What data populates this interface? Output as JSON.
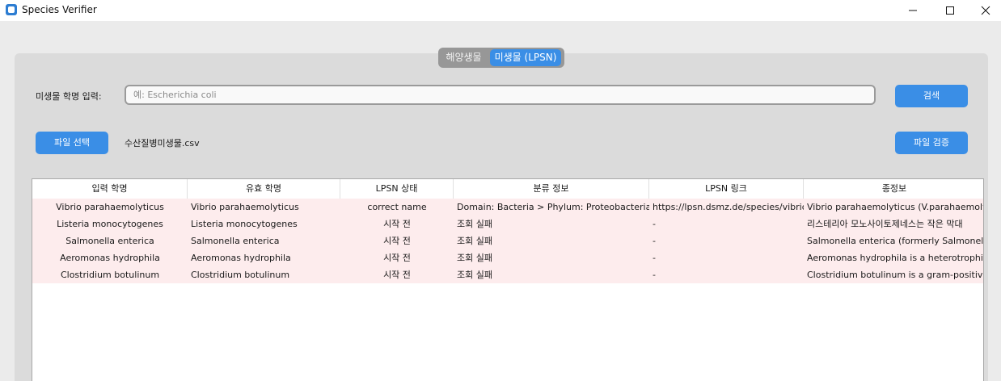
{
  "window": {
    "title": "Species Verifier",
    "controls": {
      "minimize_icon": "minimize-icon",
      "maximize_icon": "maximize-icon",
      "close_icon": "close-icon"
    }
  },
  "tabs": [
    {
      "label": "해양생물",
      "selected": false
    },
    {
      "label": "미생물 (LPSN)",
      "selected": true
    }
  ],
  "search": {
    "label": "미생물 학명 입력:",
    "placeholder": "예: Escherichia coli",
    "value": "",
    "button": "검색"
  },
  "file": {
    "select_button": "파일 선택",
    "filename": "수산질병미생물.csv",
    "verify_button": "파일 검증"
  },
  "colors": {
    "accent": "#3a8ee6",
    "row_highlight": "#fdeced",
    "panel": "#dbdbdb"
  },
  "table": {
    "columns": [
      "입력 학명",
      "유효 학명",
      "LPSN 상태",
      "분류 정보",
      "LPSN 링크",
      "종정보"
    ],
    "rows": [
      [
        "Vibrio parahaemolyticus",
        "Vibrio parahaemolyticus",
        "correct name",
        "Domain: Bacteria > Phylum: Proteobacteria >",
        "https://lpsn.dsmz.de/species/vibrio-p",
        "Vibrio parahaemolyticus (V.parahaemolyti"
      ],
      [
        "Listeria monocytogenes",
        "Listeria monocytogenes",
        "시작 전",
        "조회 실패",
        "-",
        "리스테리아 모노사이토제네스는 작은 막대"
      ],
      [
        "Salmonella enterica",
        "Salmonella enterica",
        "시작 전",
        "조회 실패",
        "-",
        "Salmonella enterica (formerly Salmonella c"
      ],
      [
        "Aeromonas hydrophila",
        "Aeromonas hydrophila",
        "시작 전",
        "조회 실패",
        "-",
        "Aeromonas hydrophila is a heterotrophic,"
      ],
      [
        "Clostridium botulinum",
        "Clostridium botulinum",
        "시작 전",
        "조회 실패",
        "-",
        "Clostridium botulinum is a gram-positive,"
      ]
    ]
  }
}
